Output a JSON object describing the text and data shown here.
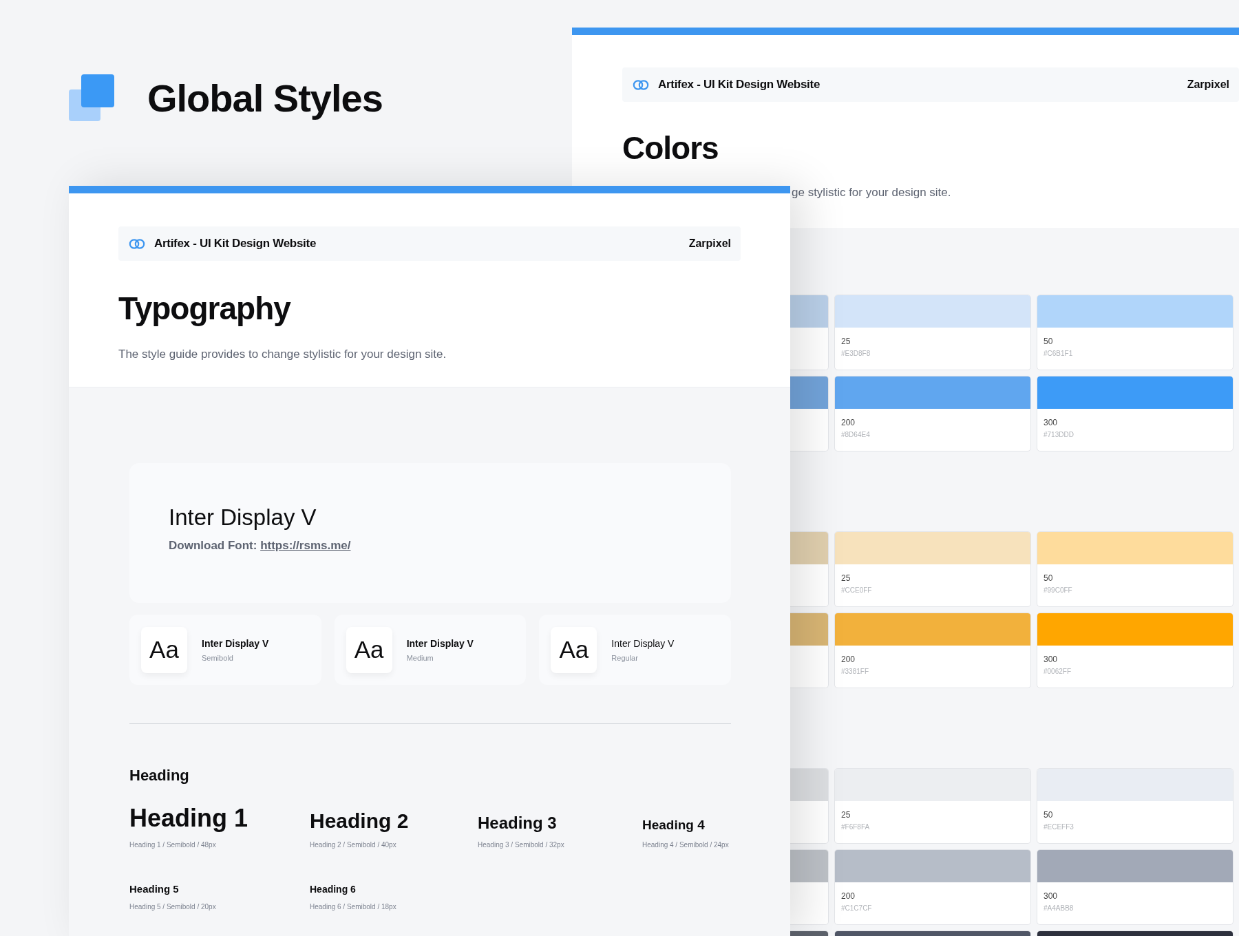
{
  "page_title": "Global Styles",
  "colors_page": {
    "site_name": "Artifex - UI Kit Design Website",
    "author": "Zarpixel",
    "title": "Colors",
    "subtitle": "ge stylistic for your design site.",
    "swatch_groups": [
      {
        "rows": [
          {
            "swatches": [
              {
                "color": "#b9cfe8"
              },
              {
                "shade": "25",
                "hex": "#E3D8F8",
                "color": "#d3e4f9"
              },
              {
                "shade": "50",
                "hex": "#C6B1F1",
                "color": "#b0d5fa"
              }
            ]
          },
          {
            "swatches": [
              {
                "color": "#72a3d9"
              },
              {
                "shade": "200",
                "hex": "#8D64E4",
                "color": "#60a6ef"
              },
              {
                "shade": "300",
                "hex": "#713DDD",
                "color": "#3d9bf7"
              }
            ]
          }
        ]
      },
      {
        "rows": [
          {
            "swatches": [
              {
                "color": "#e0cfae"
              },
              {
                "shade": "25",
                "hex": "#CCE0FF",
                "color": "#f7e2bc"
              },
              {
                "shade": "50",
                "hex": "#99C0FF",
                "color": "#fedc9c"
              }
            ]
          },
          {
            "swatches": [
              {
                "color": "#d8b574"
              },
              {
                "shade": "200",
                "hex": "#3381FF",
                "color": "#f2b13c"
              },
              {
                "shade": "300",
                "hex": "#0062FF",
                "color": "#ffa600"
              }
            ]
          }
        ]
      },
      {
        "rows": [
          {
            "swatches": [
              {
                "color": "#dcdee1"
              },
              {
                "shade": "25",
                "hex": "#F6F8FA",
                "color": "#eceef1"
              },
              {
                "shade": "50",
                "hex": "#ECEFF3",
                "color": "#e9edf3"
              }
            ]
          },
          {
            "swatches": [
              {
                "color": "#bcc0c6"
              },
              {
                "shade": "200",
                "hex": "#C1C7CF",
                "color": "#b6bdc8"
              },
              {
                "shade": "300",
                "hex": "#A4ABB8",
                "color": "#a2a9b7"
              }
            ]
          },
          {
            "swatches": [
              {
                "color": "#5d626c"
              },
              {
                "color": "#505666"
              },
              {
                "color": "#2d303d"
              }
            ]
          }
        ]
      }
    ]
  },
  "typography_page": {
    "site_name": "Artifex - UI Kit Design Website",
    "author": "Zarpixel",
    "title": "Typography",
    "subtitle": "The style guide provides to change stylistic for your design site.",
    "font_card": {
      "name": "Inter Display V",
      "download_label": "Download Font:",
      "link": "https://rsms.me/"
    },
    "weights": [
      {
        "sample": "Aa",
        "name": "Inter Display V",
        "weight": "Semibold",
        "kind": "semibold"
      },
      {
        "sample": "Aa",
        "name": "Inter Display V",
        "weight": "Medium",
        "kind": "medium"
      },
      {
        "sample": "Aa",
        "name": "Inter Display V",
        "weight": "Regular",
        "kind": "regular"
      }
    ],
    "section_label": "Heading",
    "headings": [
      {
        "text": "Heading 1",
        "spec": "Heading 1 / Semibold / 48px",
        "kind": "h1"
      },
      {
        "text": "Heading 2",
        "spec": "Heading 2 / Semibold / 40px",
        "kind": "h2"
      },
      {
        "text": "Heading 3",
        "spec": "Heading 3 / Semibold / 32px",
        "kind": "h3"
      },
      {
        "text": "Heading 4",
        "spec": "Heading 4 / Semibold / 24px",
        "kind": "h4"
      },
      {
        "text": "Heading 5",
        "spec": "Heading 5 / Semibold / 20px",
        "kind": "h5"
      },
      {
        "text": "Heading 6",
        "spec": "Heading 6 / Semibold / 18px",
        "kind": "h6"
      }
    ]
  }
}
